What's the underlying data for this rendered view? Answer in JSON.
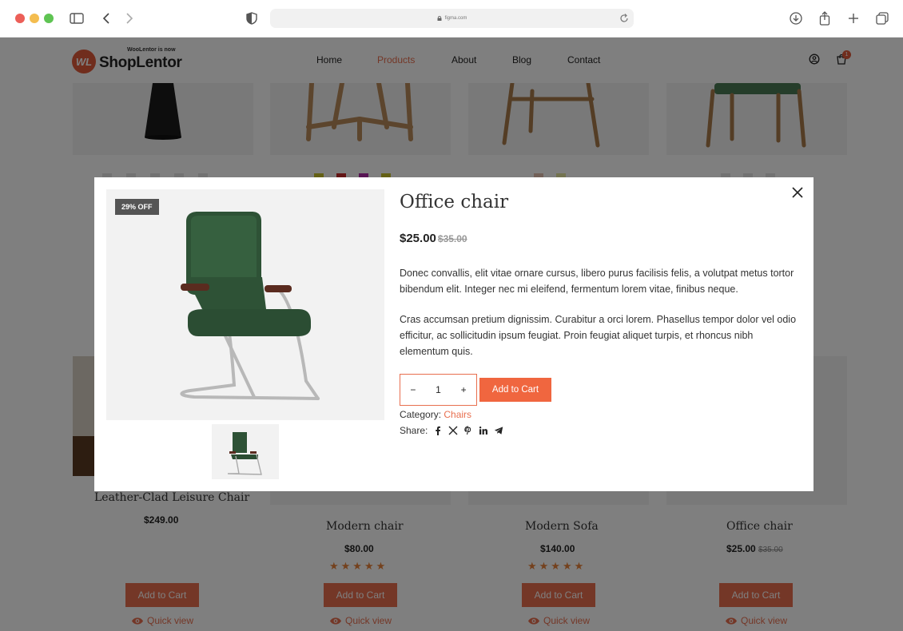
{
  "browser": {
    "url": "figma.com",
    "colors": {
      "close": "#ec5f58",
      "minimize": "#f4bd4f",
      "maximize": "#5fc453"
    }
  },
  "site": {
    "logo": {
      "tagline": "WooLentor is now",
      "name": "ShopLentor",
      "mark": "WL"
    },
    "nav": [
      {
        "label": "Home",
        "active": false
      },
      {
        "label": "Products",
        "active": true
      },
      {
        "label": "About",
        "active": false
      },
      {
        "label": "Blog",
        "active": false
      },
      {
        "label": "Contact",
        "active": false
      }
    ],
    "cart_count": "1",
    "accent": "#e86f4f",
    "products": [
      {
        "name": "Leather-Clad Leisure Chair",
        "price": "$249.00",
        "old_price": "",
        "rating": 0,
        "add_to_cart": "Add to Cart",
        "quick_view": "Quick view"
      },
      {
        "name": "Modern chair",
        "price": "$80.00",
        "old_price": "",
        "rating": 5,
        "add_to_cart": "Add to Cart",
        "quick_view": "Quick view"
      },
      {
        "name": "Modern Sofa",
        "price": "$140.00",
        "old_price": "",
        "rating": 5,
        "add_to_cart": "Add to Cart",
        "quick_view": "Quick view"
      },
      {
        "name": "Office chair",
        "price": "$25.00",
        "old_price": "$35.00",
        "rating": 0,
        "add_to_cart": "Add to Cart",
        "quick_view": "Quick view"
      }
    ]
  },
  "modal": {
    "badge": "29% OFF",
    "title": "Office chair",
    "price": "$25.00",
    "old_price": "$35.00",
    "description_1": "Donec convallis, elit vitae ornare cursus, libero purus facilisis felis, a volutpat metus tortor bibendum elit. Integer nec mi eleifend, fermentum lorem vitae, finibus neque.",
    "description_2": "Cras accumsan pretium dignissim. Curabitur a orci lorem. Phasellus tempor dolor vel odio efficitur, ac sollicitudin ipsum feugiat. Proin feugiat aliquet turpis, et rhoncus nibh elementum quis.",
    "quantity": "1",
    "minus": "−",
    "plus": "+",
    "add_to_cart": "Add to Cart",
    "category_label": "Category:",
    "category_value": "Chairs",
    "share_label": "Share:",
    "share_icons": [
      "facebook-icon",
      "x-icon",
      "pinterest-icon",
      "linkedin-icon",
      "telegram-icon"
    ]
  }
}
